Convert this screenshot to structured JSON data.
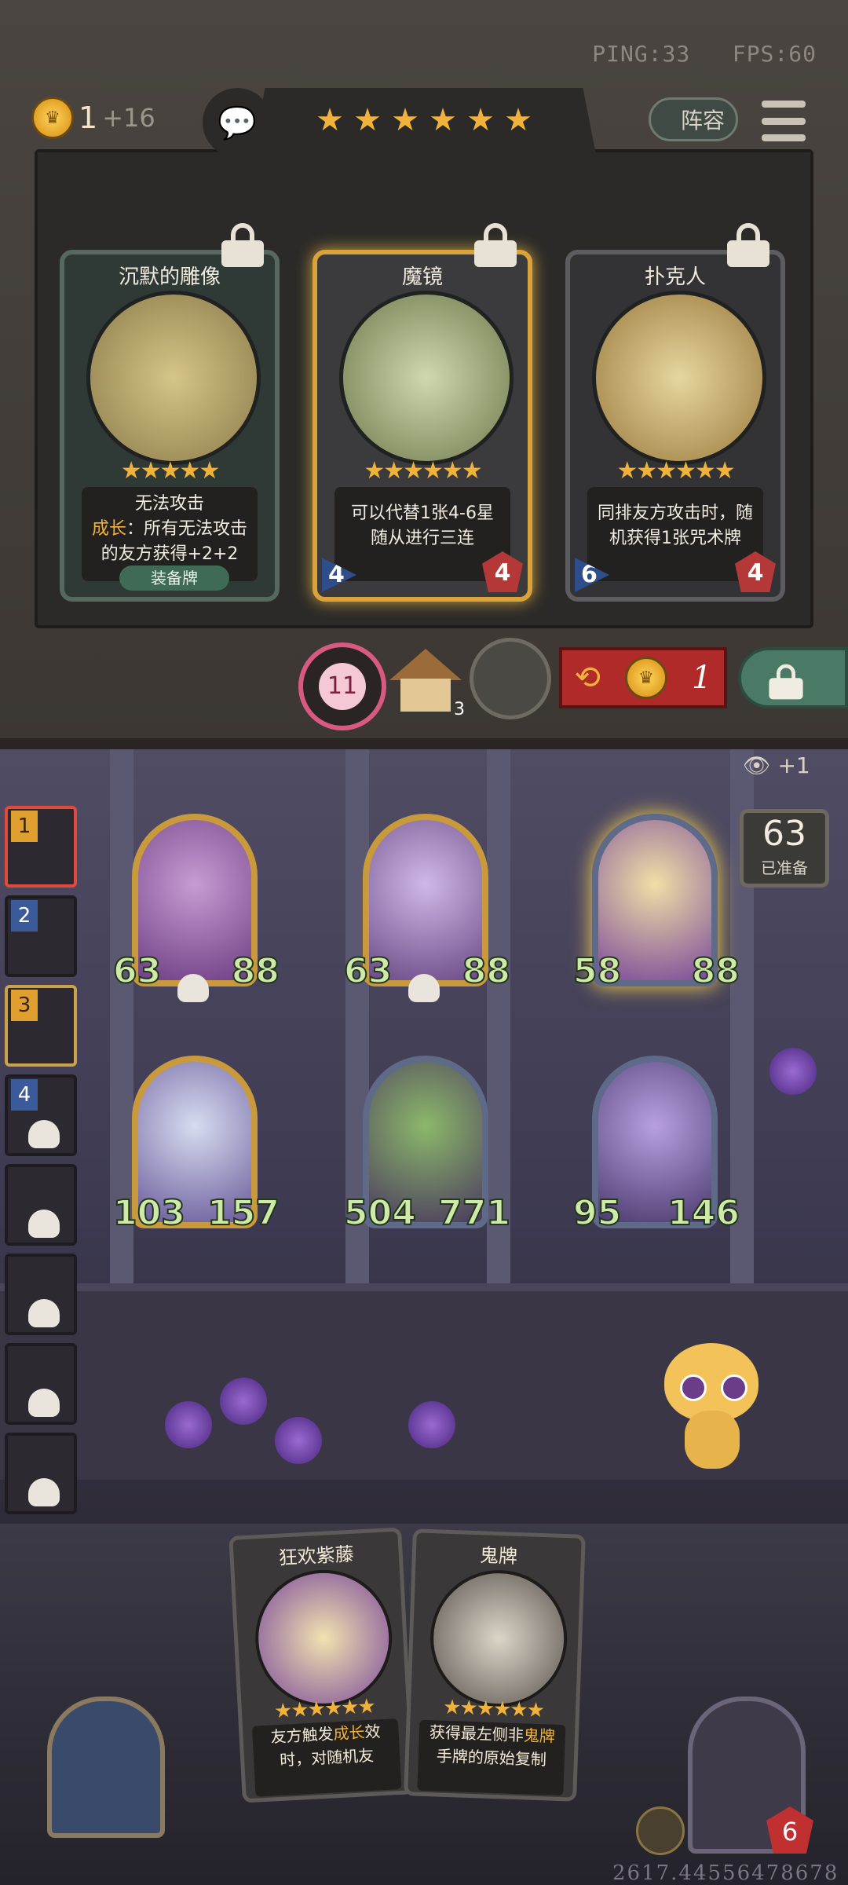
{
  "top_bar": {
    "gold": "1",
    "gold_income": "+16",
    "ping": "PING:33",
    "fps": "FPS:60",
    "tavern_stars": 6,
    "lineup_label": "阵容"
  },
  "shop": {
    "cards": [
      {
        "name": "沉默的雕像",
        "stars": 5,
        "desc_line1": "无法攻击",
        "desc_line2_prefix": "成长",
        "desc_line2_rest": "：所有无法攻击",
        "desc_line3": "的友方获得+2+2",
        "tag": "装备牌"
      },
      {
        "name": "魔镜",
        "stars": 6,
        "desc_line1": "可以代替1张4-6星",
        "desc_line2": "随从进行三连",
        "tier": "4",
        "cost": "4"
      },
      {
        "name": "扑克人",
        "stars": 6,
        "desc_line1": "同排友方攻击时，随",
        "desc_line2": "机获得1张咒术牌",
        "tier": "6",
        "cost": "4"
      }
    ],
    "refresh_count": "11",
    "tavern_level": "3",
    "reroll_cost": "1"
  },
  "board": {
    "minions": [
      {
        "attack": "63",
        "health": "88",
        "frame": "gold",
        "skull": true
      },
      {
        "attack": "63",
        "health": "88",
        "frame": "gold",
        "skull": true
      },
      {
        "attack": "58",
        "health": "88",
        "frame": "silver",
        "glow": true
      },
      {
        "attack": "103",
        "health": "157",
        "frame": "gold"
      },
      {
        "attack": "504",
        "health": "771",
        "frame": "silver"
      },
      {
        "attack": "95",
        "health": "146",
        "frame": "silver"
      }
    ],
    "spectate_bonus": "+1",
    "ready_count": "63",
    "ready_label": "已准备"
  },
  "players": [
    {
      "rank": "1",
      "state": "active"
    },
    {
      "rank": "2"
    },
    {
      "rank": "3",
      "state": "gold"
    },
    {
      "rank": "4",
      "dead": true
    },
    {
      "dead": true
    },
    {
      "dead": true
    },
    {
      "dead": true
    },
    {
      "dead": true
    }
  ],
  "hand": {
    "cards": [
      {
        "name": "狂欢紫藤",
        "stars": 6,
        "desc_line1_prefix": "友方触发",
        "desc_line1_hl": "成长",
        "desc_line1_rest": "效",
        "desc_line2": "时，对随机友"
      },
      {
        "name": "鬼牌",
        "stars": 6,
        "desc_line1_prefix": "获得最左侧非",
        "desc_line1_hl": "鬼牌",
        "desc_line2": "手牌的原始复制"
      }
    ]
  },
  "hero": {
    "health": "6"
  },
  "game_id": "2617.44556478678"
}
